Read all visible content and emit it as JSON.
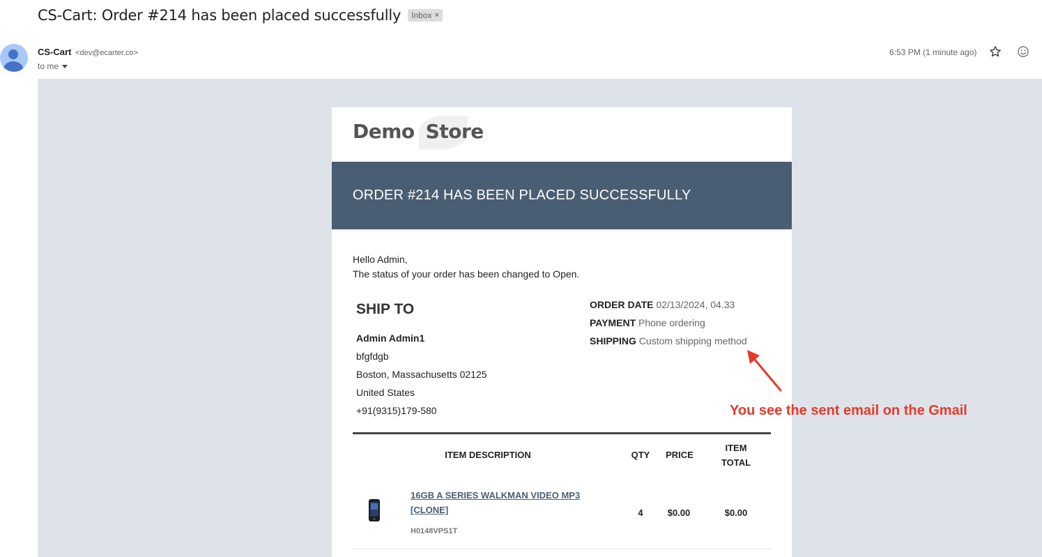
{
  "email": {
    "subject": "CS-Cart: Order #214 has been placed successfully",
    "label": "Inbox",
    "label_close": "×",
    "sender_name": "CS-Cart",
    "sender_email": "<dev@ecarter.co>",
    "recipient": "to me",
    "timestamp": "6:53 PM (1 minute ago)"
  },
  "store": {
    "logo_word1": "Demo",
    "logo_word2": "Store"
  },
  "banner": {
    "title": "ORDER #214 HAS BEEN PLACED SUCCESSFULLY",
    "color": "#4a5e73"
  },
  "greeting": {
    "line1": "Hello Admin,",
    "line2": "The status of your order has been changed to Open."
  },
  "ship_to": {
    "title": "SHIP TO",
    "name": "Admin Admin1",
    "line1": "bfgfdgb",
    "line2": "Boston, Massachusetts 02125",
    "country": "United States",
    "phone": "+91(9315)179-580"
  },
  "order_meta": {
    "date_label": "ORDER DATE",
    "date_value": "02/13/2024, 04.33",
    "payment_label": "PAYMENT",
    "payment_value": "Phone ordering",
    "shipping_label": "SHIPPING",
    "shipping_value": "Custom shipping method"
  },
  "items_table": {
    "headers": {
      "description": "ITEM DESCRIPTION",
      "qty": "QTY",
      "price": "PRICE",
      "total_line1": "ITEM",
      "total_line2": "TOTAL"
    },
    "rows": [
      {
        "name_line1": "16GB A SERIES WALKMAN VIDEO MP3",
        "name_line2": "[CLONE]",
        "sku": "H0148VPS1T",
        "qty": "4",
        "price": "$0.00",
        "total": "$0.00"
      }
    ]
  },
  "annotation": {
    "text": "You see the sent email on the Gmail",
    "color": "#e8392a"
  }
}
